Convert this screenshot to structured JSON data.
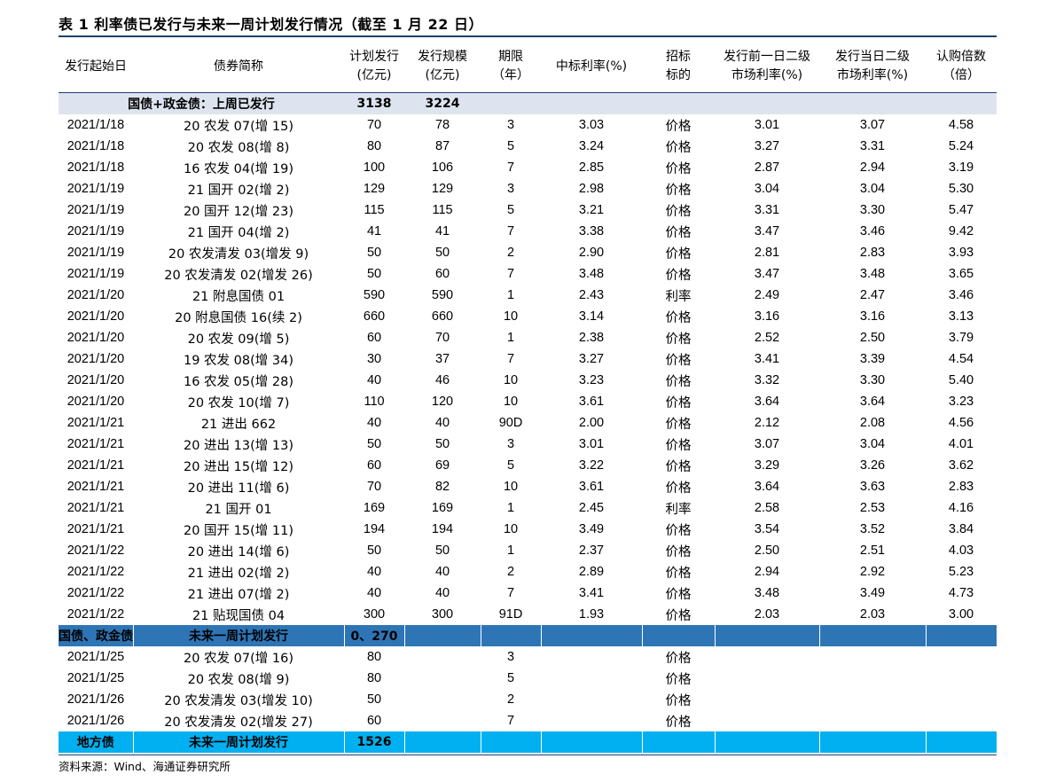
{
  "title": "表 1 利率债已发行与未来一周计划发行情况（截至 1 月 22 日）",
  "headers": [
    [
      "发行起始日"
    ],
    [
      "债券简称"
    ],
    [
      "计划发行",
      "(亿元)"
    ],
    [
      "发行规模",
      "(亿元)"
    ],
    [
      "期限",
      "（年）"
    ],
    [
      "中标利率(%)"
    ],
    [
      "招标",
      "标的"
    ],
    [
      "发行前一日二级",
      "市场利率(%)"
    ],
    [
      "发行当日二级",
      "市场利率(%)"
    ],
    [
      "认购倍数",
      "（倍）"
    ]
  ],
  "section1": {
    "label": "国债+政金债：上周已发行",
    "planned": "3138",
    "issued": "3224"
  },
  "rows1": [
    [
      "2021/1/18",
      "20 农发 07(增 15)",
      "70",
      "78",
      "3",
      "3.03",
      "价格",
      "3.01",
      "3.07",
      "4.58"
    ],
    [
      "2021/1/18",
      "20 农发 08(增 8)",
      "80",
      "87",
      "5",
      "3.24",
      "价格",
      "3.27",
      "3.31",
      "5.24"
    ],
    [
      "2021/1/18",
      "16 农发 04(增 19)",
      "100",
      "106",
      "7",
      "2.85",
      "价格",
      "2.87",
      "2.94",
      "3.19"
    ],
    [
      "2021/1/19",
      "21 国开 02(增 2)",
      "129",
      "129",
      "3",
      "2.98",
      "价格",
      "3.04",
      "3.04",
      "5.30"
    ],
    [
      "2021/1/19",
      "20 国开 12(增 23)",
      "115",
      "115",
      "5",
      "3.21",
      "价格",
      "3.31",
      "3.30",
      "5.47"
    ],
    [
      "2021/1/19",
      "21 国开 04(增 2)",
      "41",
      "41",
      "7",
      "3.38",
      "价格",
      "3.47",
      "3.46",
      "9.42"
    ],
    [
      "2021/1/19",
      "20 农发清发 03(增发 9)",
      "50",
      "50",
      "2",
      "2.90",
      "价格",
      "2.81",
      "2.83",
      "3.93"
    ],
    [
      "2021/1/19",
      "20 农发清发 02(增发 26)",
      "50",
      "60",
      "7",
      "3.48",
      "价格",
      "3.47",
      "3.48",
      "3.65"
    ],
    [
      "2021/1/20",
      "21 附息国债 01",
      "590",
      "590",
      "1",
      "2.43",
      "利率",
      "2.49",
      "2.47",
      "3.46"
    ],
    [
      "2021/1/20",
      "20 附息国债 16(续 2)",
      "660",
      "660",
      "10",
      "3.14",
      "价格",
      "3.16",
      "3.16",
      "3.13"
    ],
    [
      "2021/1/20",
      "20 农发 09(增 5)",
      "60",
      "70",
      "1",
      "2.38",
      "价格",
      "2.52",
      "2.50",
      "3.79"
    ],
    [
      "2021/1/20",
      "19 农发 08(增 34)",
      "30",
      "37",
      "7",
      "3.27",
      "价格",
      "3.41",
      "3.39",
      "4.54"
    ],
    [
      "2021/1/20",
      "16 农发 05(增 28)",
      "40",
      "46",
      "10",
      "3.23",
      "价格",
      "3.32",
      "3.30",
      "5.40"
    ],
    [
      "2021/1/20",
      "20 农发 10(增 7)",
      "110",
      "120",
      "10",
      "3.61",
      "价格",
      "3.64",
      "3.64",
      "3.23"
    ],
    [
      "2021/1/21",
      "21 进出 662",
      "40",
      "40",
      "90D",
      "2.00",
      "价格",
      "2.12",
      "2.08",
      "4.56"
    ],
    [
      "2021/1/21",
      "20 进出 13(增 13)",
      "50",
      "50",
      "3",
      "3.01",
      "价格",
      "3.07",
      "3.04",
      "4.01"
    ],
    [
      "2021/1/21",
      "20 进出 15(增 12)",
      "60",
      "69",
      "5",
      "3.22",
      "价格",
      "3.29",
      "3.26",
      "3.62"
    ],
    [
      "2021/1/21",
      "20 进出 11(增 6)",
      "70",
      "82",
      "10",
      "3.61",
      "价格",
      "3.64",
      "3.63",
      "2.83"
    ],
    [
      "2021/1/21",
      "21 国开 01",
      "169",
      "169",
      "1",
      "2.45",
      "利率",
      "2.58",
      "2.53",
      "4.16"
    ],
    [
      "2021/1/21",
      "20 国开 15(增 11)",
      "194",
      "194",
      "10",
      "3.49",
      "价格",
      "3.54",
      "3.52",
      "3.84"
    ],
    [
      "2021/1/22",
      "20 进出 14(增 6)",
      "50",
      "50",
      "1",
      "2.37",
      "价格",
      "2.50",
      "2.51",
      "4.03"
    ],
    [
      "2021/1/22",
      "21 进出 02(增 2)",
      "40",
      "40",
      "2",
      "2.89",
      "价格",
      "2.94",
      "2.92",
      "5.23"
    ],
    [
      "2021/1/22",
      "21 进出 07(增 2)",
      "40",
      "40",
      "7",
      "3.41",
      "价格",
      "3.48",
      "3.49",
      "4.73"
    ],
    [
      "2021/1/22",
      "21 贴现国债 04",
      "300",
      "300",
      "91D",
      "1.93",
      "价格",
      "2.03",
      "2.03",
      "3.00"
    ]
  ],
  "section2": {
    "label_a": "国债、政金债",
    "label_b": "未来一周计划发行",
    "planned": "0、270"
  },
  "rows2": [
    [
      "2021/1/25",
      "20 农发 07(增 16)",
      "80",
      "",
      "3",
      "",
      "价格",
      "",
      "",
      ""
    ],
    [
      "2021/1/25",
      "20 农发 08(增 9)",
      "80",
      "",
      "5",
      "",
      "价格",
      "",
      "",
      ""
    ],
    [
      "2021/1/26",
      "20 农发清发 03(增发 10)",
      "50",
      "",
      "2",
      "",
      "价格",
      "",
      "",
      ""
    ],
    [
      "2021/1/26",
      "20 农发清发 02(增发 27)",
      "60",
      "",
      "7",
      "",
      "价格",
      "",
      "",
      ""
    ]
  ],
  "section3": {
    "label_a": "地方债",
    "label_b": "未来一周计划发行",
    "planned": "1526"
  },
  "source": "资料来源：Wind、海通证券研究所",
  "colors": {
    "rule": "#1f3f6e",
    "section1_bg": "#dde4ef",
    "section2_bg": "#2e75b6",
    "section3_bg": "#00b0f0"
  }
}
